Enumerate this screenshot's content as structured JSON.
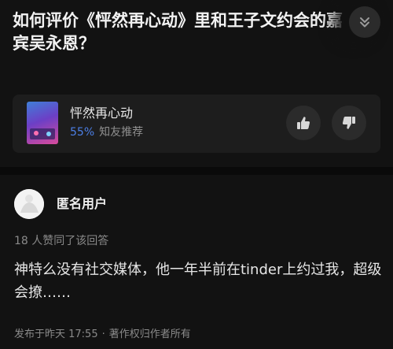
{
  "question": {
    "title": "如何评价《怦然再心动》里和王子文约会的嘉宾吴永恩？"
  },
  "show_card": {
    "name": "怦然再心动",
    "percent": "55%",
    "recommend_label": "知友推荐",
    "poster_text": "怦然再心动"
  },
  "answer": {
    "author": "匿名用户",
    "likes_text": "18 人赞同了该回答",
    "body": "神特么没有社交媒体，他一年半前在tinder上约过我，超级会撩……",
    "posted": "发布于昨天 17:55",
    "separator": "·",
    "copyright": "著作权归作者所有"
  },
  "colors": {
    "background": "#121212",
    "card": "#1d1d1d",
    "accent": "#4c7fe6"
  }
}
